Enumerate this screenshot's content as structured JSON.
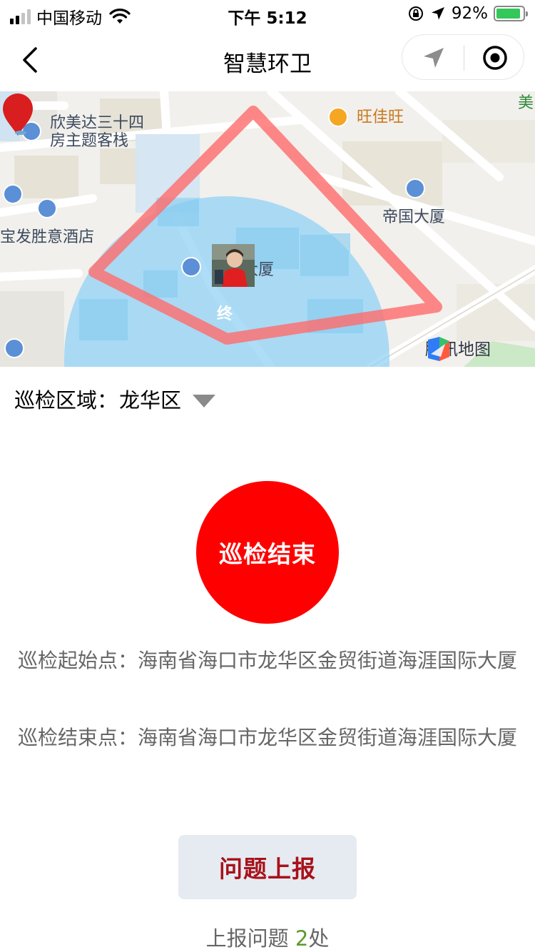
{
  "status_bar": {
    "carrier": "中国移动",
    "time": "下午 5:12",
    "battery_percent": "92%",
    "battery_level": 0.92,
    "signal_bars_active": 2
  },
  "nav": {
    "title": "智慧环卫",
    "back_icon": "chevron-left-icon",
    "location_icon": "location-arrow-icon",
    "record_icon": "record-circle-icon"
  },
  "map": {
    "labels": {
      "hotel_xinmeida": "欣美达三十四\n房主题客栈",
      "wangjiawang": "旺佳旺",
      "diguo_dasha": "帝国大厦",
      "baofa_hotel": "宝发胜意酒店",
      "dasha": "大厦",
      "mei": "美"
    },
    "end_marker_text": "终",
    "provider": "腾讯地图",
    "colors": {
      "route": "#ff6b6b",
      "range_circle": "#8fd0f5"
    }
  },
  "region": {
    "label": "巡检区域：",
    "value": "龙华区"
  },
  "end_button": {
    "label": "巡检结束",
    "color": "#ff0000"
  },
  "patrol": {
    "start_label": "巡检起始点：",
    "start_address": "海南省海口市龙华区金贸街道海涯国际大厦",
    "end_label": "巡检结束点：",
    "end_address": "海南省海口市龙华区金贸街道海涯国际大厦"
  },
  "report": {
    "button_label": "问题上报",
    "count_prefix": "上报问题 ",
    "count": "2",
    "count_suffix": "处"
  }
}
